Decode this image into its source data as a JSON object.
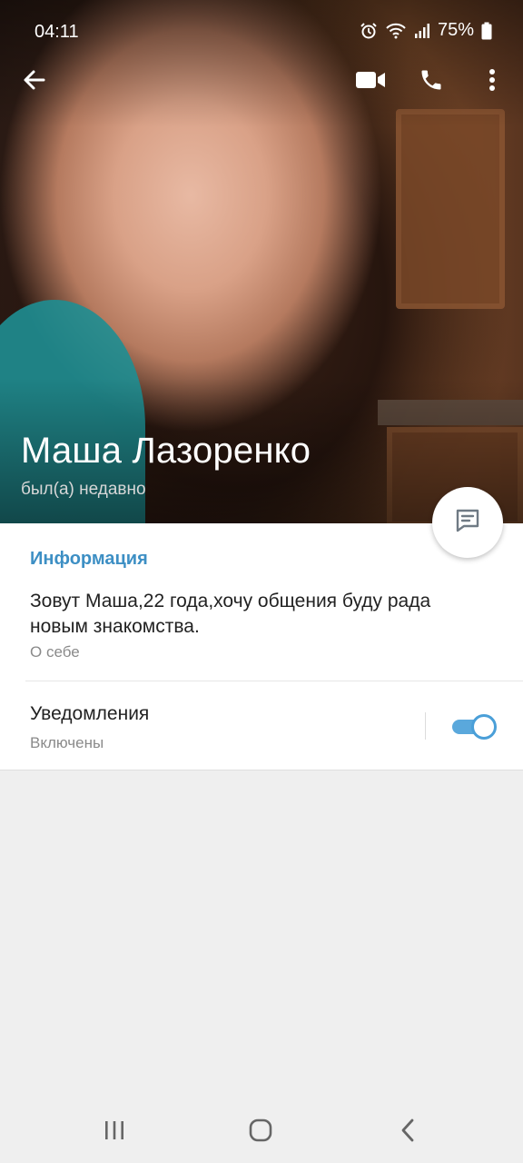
{
  "status_bar": {
    "time": "04:11",
    "battery": "75%",
    "icons": [
      "alarm-icon",
      "wifi-icon",
      "signal-icon",
      "battery-icon"
    ]
  },
  "toolbar": {
    "icons": [
      "arrow-left-icon",
      "video-camera-icon",
      "phone-icon",
      "more-vertical-icon"
    ]
  },
  "profile": {
    "name": "Маша Лазоренко",
    "last_seen": "был(а) недавно"
  },
  "info": {
    "section_title": "Информация",
    "bio": "Зовут Маша,22 года,хочу общения буду рада новым знакомства.",
    "bio_caption": "О себе"
  },
  "notifications": {
    "title": "Уведомления",
    "status": "Включены",
    "enabled": true
  },
  "colors": {
    "accent": "#3d8fc4",
    "toggle": "#5aa8dc",
    "background": "#efefef"
  },
  "nav_bar": {
    "icons": [
      "recents-icon",
      "home-icon",
      "back-icon"
    ]
  }
}
